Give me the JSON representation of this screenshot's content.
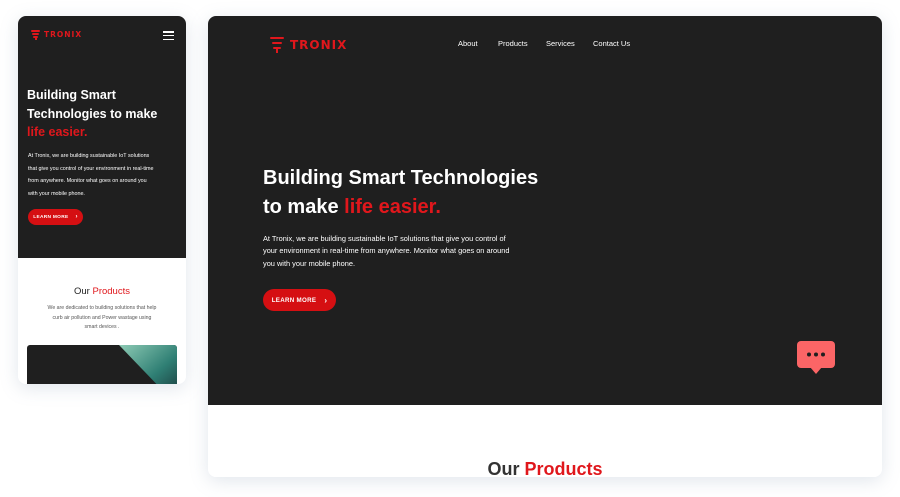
{
  "brand": {
    "name": "TRONIX",
    "accent": "#e0171c"
  },
  "mobile": {
    "menu_icon": "hamburger-icon",
    "hero": {
      "title_line1": "Building Smart",
      "title_line2": "Technologies to make",
      "title_highlight": "life easier.",
      "desc_line1": "At Tronix, we are building sustainable  IoT solutions",
      "desc_line2": "that give you control of your environment in real-time",
      "desc_line3": "from anywhere. Monitor what goes on around you",
      "desc_line4": "with your mobile phone.",
      "cta": "LEARN MORE",
      "cta_icon": "chevron-right-icon"
    },
    "products": {
      "title_plain": "Our",
      "title_highlight": "Products",
      "desc_line1": "We are dedicated to building solutions that help",
      "desc_line2": "curb air pollution and  Power wastage using",
      "desc_line3": "smart devices ."
    }
  },
  "desktop": {
    "nav": [
      "About",
      "Products",
      "Services",
      "Contact Us"
    ],
    "hero": {
      "title_line1": "Building Smart Technologies",
      "title_line2": "to make",
      "title_highlight": "life easier.",
      "desc_line1": "At Tronix, we are building sustainable  IoT solutions that give you control of",
      "desc_line2": "your environment in real-time from anywhere. Monitor what goes on around",
      "desc_line3": "you with your mobile phone.",
      "cta": "LEARN MORE",
      "cta_icon": "chevron-right-icon"
    },
    "chat_icon": "chat-bubble-icon",
    "products": {
      "title_plain": "Our",
      "title_highlight": "Products"
    }
  }
}
